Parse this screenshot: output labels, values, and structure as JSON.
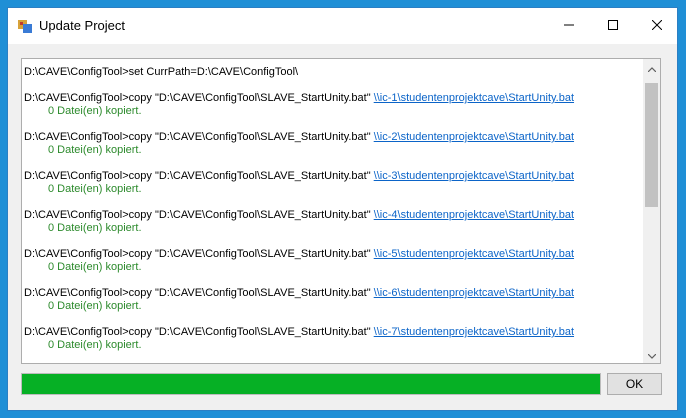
{
  "window": {
    "title": "Update Project",
    "ok_label": "OK"
  },
  "progress": {
    "percent": 100,
    "color": "#06b025"
  },
  "output": {
    "first_line": "D:\\CAVE\\ConfigTool>set CurrPath=D:\\CAVE\\ConfigTool\\",
    "entries": [
      {
        "cmd": "D:\\CAVE\\ConfigTool>copy \"D:\\CAVE\\ConfigTool\\SLAVE_StartUnity.bat\" ",
        "link": "\\\\ic-1\\studentenprojektcave\\StartUnity.bat",
        "result": "0 Datei(en) kopiert."
      },
      {
        "cmd": "D:\\CAVE\\ConfigTool>copy \"D:\\CAVE\\ConfigTool\\SLAVE_StartUnity.bat\" ",
        "link": "\\\\ic-2\\studentenprojektcave\\StartUnity.bat",
        "result": "0 Datei(en) kopiert."
      },
      {
        "cmd": "D:\\CAVE\\ConfigTool>copy \"D:\\CAVE\\ConfigTool\\SLAVE_StartUnity.bat\" ",
        "link": "\\\\ic-3\\studentenprojektcave\\StartUnity.bat",
        "result": "0 Datei(en) kopiert."
      },
      {
        "cmd": "D:\\CAVE\\ConfigTool>copy \"D:\\CAVE\\ConfigTool\\SLAVE_StartUnity.bat\" ",
        "link": "\\\\ic-4\\studentenprojektcave\\StartUnity.bat",
        "result": "0 Datei(en) kopiert."
      },
      {
        "cmd": "D:\\CAVE\\ConfigTool>copy \"D:\\CAVE\\ConfigTool\\SLAVE_StartUnity.bat\" ",
        "link": "\\\\ic-5\\studentenprojektcave\\StartUnity.bat",
        "result": "0 Datei(en) kopiert."
      },
      {
        "cmd": "D:\\CAVE\\ConfigTool>copy \"D:\\CAVE\\ConfigTool\\SLAVE_StartUnity.bat\" ",
        "link": "\\\\ic-6\\studentenprojektcave\\StartUnity.bat",
        "result": "0 Datei(en) kopiert."
      },
      {
        "cmd": "D:\\CAVE\\ConfigTool>copy \"D:\\CAVE\\ConfigTool\\SLAVE_StartUnity.bat\" ",
        "link": "\\\\ic-7\\studentenprojektcave\\StartUnity.bat",
        "result": "0 Datei(en) kopiert."
      }
    ]
  }
}
